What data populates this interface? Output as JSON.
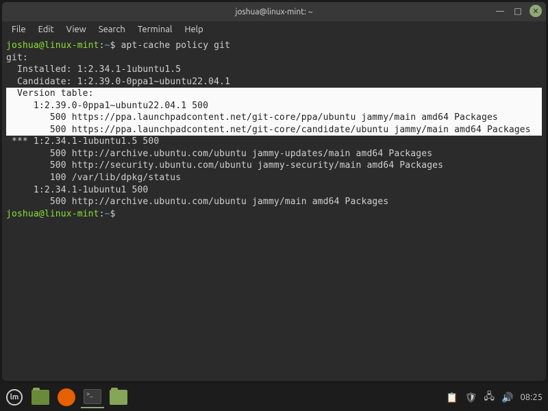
{
  "window": {
    "title": "joshua@linux-mint: ~"
  },
  "menubar": [
    "File",
    "Edit",
    "View",
    "Search",
    "Terminal",
    "Help"
  ],
  "prompt": {
    "user_host": "joshua@linux-mint",
    "sep1": ":",
    "path": "~",
    "sep2": "$ "
  },
  "terminal": {
    "command": "apt-cache policy git",
    "lines": [
      "git:",
      "  Installed: 1:2.34.1-1ubuntu1.5",
      "  Candidate: 1:2.39.0-0ppa1~ubuntu22.04.1"
    ],
    "highlighted": [
      "  Version table:",
      "     1:2.39.0-0ppa1~ubuntu22.04.1 500",
      "        500 https://ppa.launchpadcontent.net/git-core/ppa/ubuntu jammy/main amd64 Packages",
      "        500 https://ppa.launchpadcontent.net/git-core/candidate/ubuntu jammy/main amd64 Packages"
    ],
    "lines2": [
      " *** 1:2.34.1-1ubuntu1.5 500",
      "        500 http://archive.ubuntu.com/ubuntu jammy-updates/main amd64 Packages",
      "        500 http://security.ubuntu.com/ubuntu jammy-security/main amd64 Packages",
      "        100 /var/lib/dpkg/status",
      "     1:2.34.1-1ubuntu1 500",
      "        500 http://archive.ubuntu.com/ubuntu jammy/main amd64 Packages"
    ]
  },
  "taskbar": {
    "clock": "08:25"
  }
}
